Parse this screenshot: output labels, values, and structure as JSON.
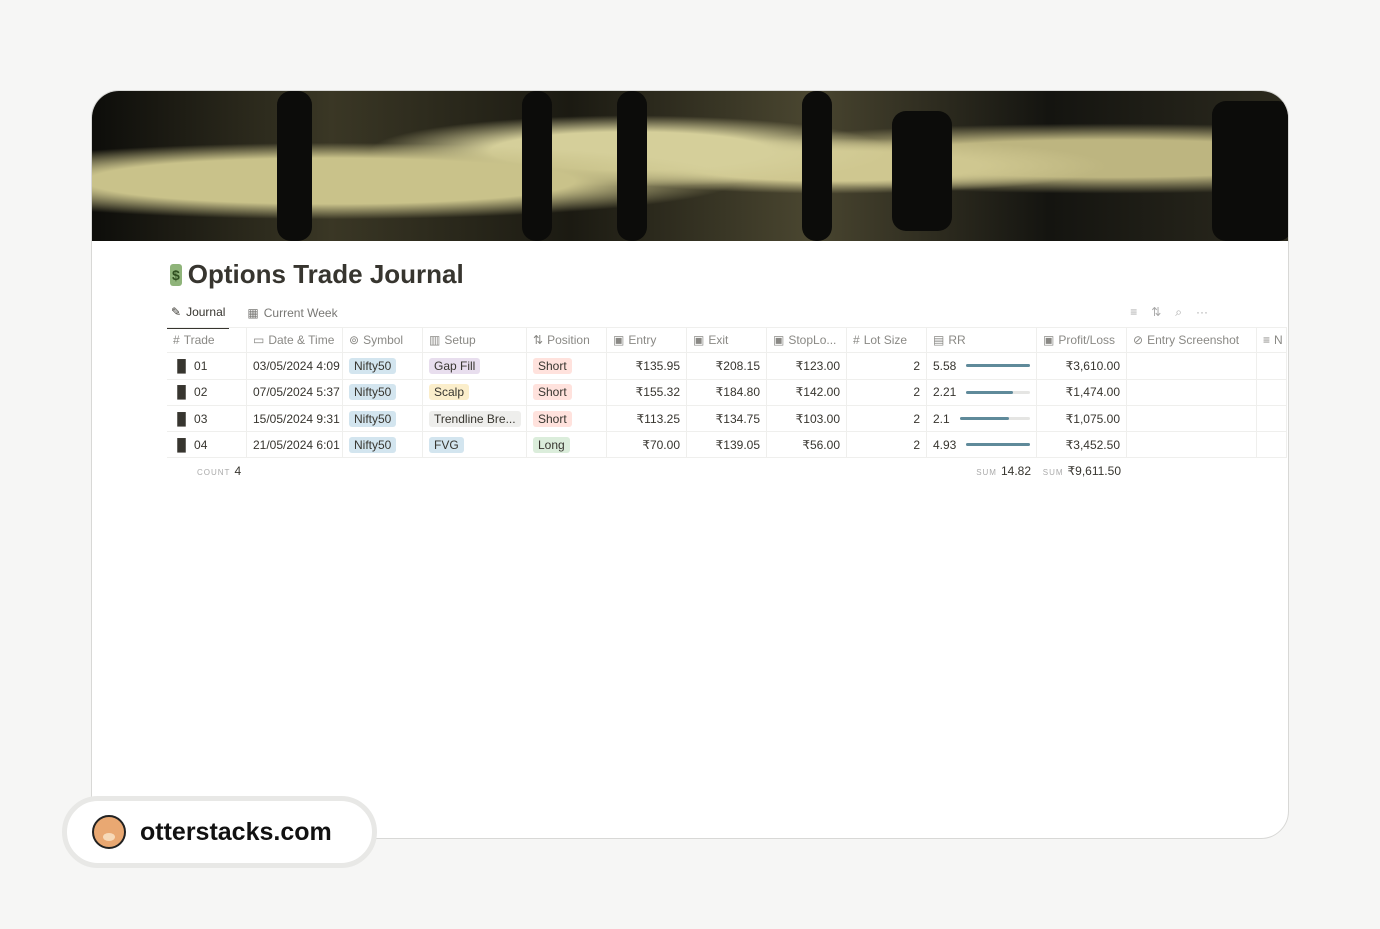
{
  "title": "Options Trade Journal",
  "title_icon": "money-bag-emoji",
  "tabs": [
    {
      "label": "Journal",
      "icon": "journal-icon"
    },
    {
      "label": "Current Week",
      "icon": "calendar-icon"
    }
  ],
  "columns": [
    "Trade",
    "Date & Time",
    "Symbol",
    "Setup",
    "Position",
    "Entry",
    "Exit",
    "StopLo...",
    "Lot Size",
    "RR",
    "Profit/Loss",
    "Entry Screenshot",
    "N"
  ],
  "rows": [
    {
      "trade": "01",
      "date": "03/05/2024 4:09",
      "symbol": "Nifty50",
      "setup": "Gap Fill",
      "position": "Short",
      "entry": "₹135.95",
      "exit": "₹208.15",
      "stop": "₹123.00",
      "lot": "2",
      "rr": "5.58",
      "rr_fill": 1.0,
      "pl": "₹3,610.00"
    },
    {
      "trade": "02",
      "date": "07/05/2024 5:37",
      "symbol": "Nifty50",
      "setup": "Scalp",
      "position": "Short",
      "entry": "₹155.32",
      "exit": "₹184.80",
      "stop": "₹142.00",
      "lot": "2",
      "rr": "2.21",
      "rr_fill": 0.74,
      "pl": "₹1,474.00"
    },
    {
      "trade": "03",
      "date": "15/05/2024 9:31",
      "symbol": "Nifty50",
      "setup": "Trendline Bre...",
      "position": "Short",
      "entry": "₹113.25",
      "exit": "₹134.75",
      "stop": "₹103.00",
      "lot": "2",
      "rr": "2.1",
      "rr_fill": 0.7,
      "pl": "₹1,075.00"
    },
    {
      "trade": "04",
      "date": "21/05/2024 6:01",
      "symbol": "Nifty50",
      "setup": "FVG",
      "position": "Long",
      "entry": "₹70.00",
      "exit": "₹139.05",
      "stop": "₹56.00",
      "lot": "2",
      "rr": "4.93",
      "rr_fill": 1.0,
      "pl": "₹3,452.50"
    }
  ],
  "footer": {
    "count_label": "COUNT",
    "count": "4",
    "sum_label": "SUM",
    "rr_sum": "14.82",
    "pl_sum": "₹9,611.50"
  },
  "brand": "otterstacks.com",
  "colors": {
    "setup": {
      "Gap Fill": "#e8deee",
      "Scalp": "#fbeecb",
      "Trendline Bre...": "#eeeeec",
      "FVG": "#d3e5ef"
    },
    "position": {
      "Short": "#ffe2dd",
      "Long": "#dbeddb"
    },
    "symbol": "#d3e5ef",
    "rr_bar": "#5f8a9a"
  }
}
